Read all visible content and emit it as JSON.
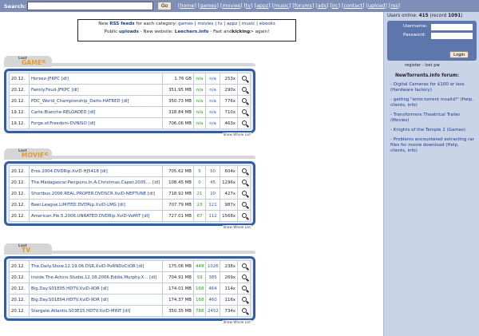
{
  "topbar": {
    "search_label": "Search:",
    "search_value": "",
    "go_label": "Go",
    "nav": [
      "home",
      "games",
      "movies",
      "tv",
      "appz",
      "music",
      "forums",
      "ads",
      "irc",
      "contact",
      "upload",
      "rss"
    ]
  },
  "info": {
    "line1_prefix": "New",
    "rss_label": "RSS feeds",
    "line1_mid": "for each category:",
    "categories": [
      "games",
      "movies",
      "tv",
      "appz",
      "music",
      "ebooks"
    ],
    "line2_prefix": "Public",
    "uploads_label": "uploads",
    "line2_mid": "- New website:",
    "website_label": "Leechers.info",
    "line2_and": "- Fast and",
    "kicking_label": "kicking",
    "line2_suffix": "> again!"
  },
  "sections": [
    {
      "tag": "Last",
      "name": "GAMES",
      "show_all": "Show Whole List",
      "rows": [
        {
          "date": "20.12.",
          "name": "Horsez-JFKPC",
          "dl": "[dl]",
          "size": "1.76 GB",
          "seed": "n/a",
          "leech": "n/a",
          "downloads": "253x"
        },
        {
          "date": "20.12.",
          "name": "Family.Feud-JFKPC",
          "dl": "[dl]",
          "size": "351.95 MB",
          "seed": "n/a",
          "leech": "n/a",
          "downloads": "290x"
        },
        {
          "date": "20.12.",
          "name": "PDC_World_Championship_Darts-HATRED",
          "dl": "[dl]",
          "size": "350.73 MB",
          "seed": "n/a",
          "leech": "n/a",
          "downloads": "776x"
        },
        {
          "date": "19.12.",
          "name": "Carte.Blanche-RELOADED",
          "dl": "[dl]",
          "size": "318.84 MB",
          "seed": "n/a",
          "leech": "n/a",
          "downloads": "710x"
        },
        {
          "date": "19.12.",
          "name": "Forge.of.Freedom-DVNISO",
          "dl": "[dl]",
          "size": "706.06 MB",
          "seed": "n/a",
          "leech": "n/a",
          "downloads": "463x"
        }
      ]
    },
    {
      "tag": "Last",
      "name": "MOVIES",
      "show_all": "Show Whole List",
      "rows": [
        {
          "date": "20.12.",
          "name": "Eros.2004.DVDRip.XviD-HJ5418",
          "dl": "[dl]",
          "size": "705.62 MB",
          "seed": "5",
          "leech": "50",
          "downloads": "604x"
        },
        {
          "date": "20.12.",
          "name": "The.Madagascar.Penguins.In.A.Christmas.Caper.2005....",
          "dl": "[dl]",
          "size": "108.45 MB",
          "seed": "0",
          "leech": "45",
          "downloads": "1296x"
        },
        {
          "date": "20.12.",
          "name": "Shortbus.2006.REAL.PROPER.DVDSCR.XviD-NEPTUNE",
          "dl": "[dl]",
          "size": "718.92 MB",
          "seed": "21",
          "leech": "20",
          "downloads": "427x"
        },
        {
          "date": "20.12.",
          "name": "Beer.League.LiMiTED.DVDRip.XviD-LMG",
          "dl": "[dl]",
          "size": "707.79 MB",
          "seed": "23",
          "leech": "121",
          "downloads": "987x"
        },
        {
          "date": "20.12.",
          "name": "American.Pie.5.2006.UNRATED.DVDRip.XviD-VoMiT",
          "dl": "[dl]",
          "size": "727.01 MB",
          "seed": "67",
          "leech": "112",
          "downloads": "1568x"
        }
      ]
    },
    {
      "tag": "Last",
      "name": "TV",
      "show_all": "Show Whole List",
      "rows": [
        {
          "date": "20.12.",
          "name": "The.Daily.Show.12.19.06.DSR.XviD-PoRNDoCtOR",
          "dl": "[dl]",
          "size": "175.06 MB",
          "seed": "449",
          "leech": "1026",
          "downloads": "238x"
        },
        {
          "date": "20.12.",
          "name": "Inside.The.Actors.Studio.12.18.2006.Eddie.Murphy.X...",
          "dl": "[dl]",
          "size": "704.91 MB",
          "seed": "93",
          "leech": "385",
          "downloads": "269x"
        },
        {
          "date": "20.12.",
          "name": "Big.Day.S01E05.HDTV.XviD-XOR",
          "dl": "[dl]",
          "size": "174.01 MB",
          "seed": "168",
          "leech": "464",
          "downloads": "114x"
        },
        {
          "date": "20.12.",
          "name": "Big.Day.S01E04.HDTV.XviD-XOR",
          "dl": "[dl]",
          "size": "174.37 MB",
          "seed": "168",
          "leech": "460",
          "downloads": "116x"
        },
        {
          "date": "20.12.",
          "name": "Stargate.Atlantis.S03E15.HDTV.XviD-MiNT",
          "dl": "[dl]",
          "size": "350.35 MB",
          "seed": "788",
          "leech": "2452",
          "downloads": "734x"
        }
      ]
    }
  ],
  "sidebar": {
    "users_label": "Users online:",
    "users_count": "415",
    "record_label": "(record",
    "record_count": "1091",
    "record_close": ")",
    "username_label": "Username:",
    "password_label": "Password:",
    "login_label": "Login",
    "register_label": "register",
    "lostpw_label": "lost pw",
    "forum_title": "NewTorrents.info forum:",
    "forum_items": [
      "- Digital Cameras for $100 or less (Hardware factory)",
      "- getting \"error.torrent invalid!\" (Help, clients, info)",
      "- Transformers Theatrical Trailer (Movies)",
      "- Knights of the Temple 2 (Games)",
      "- Problems encountered extracting rar files for movie download (Help, clients, info)"
    ]
  },
  "colors": {
    "topbar": "#7d8fb8",
    "section_border": "#2f5fa7",
    "section_fill": "#e5ecf7",
    "sidebar": "#c9d4e8",
    "login_box": "#5d77ad",
    "seed_green": "#1f9a1f",
    "leech_blue": "#2a55c5",
    "heading_orange": "#e69a2a"
  }
}
